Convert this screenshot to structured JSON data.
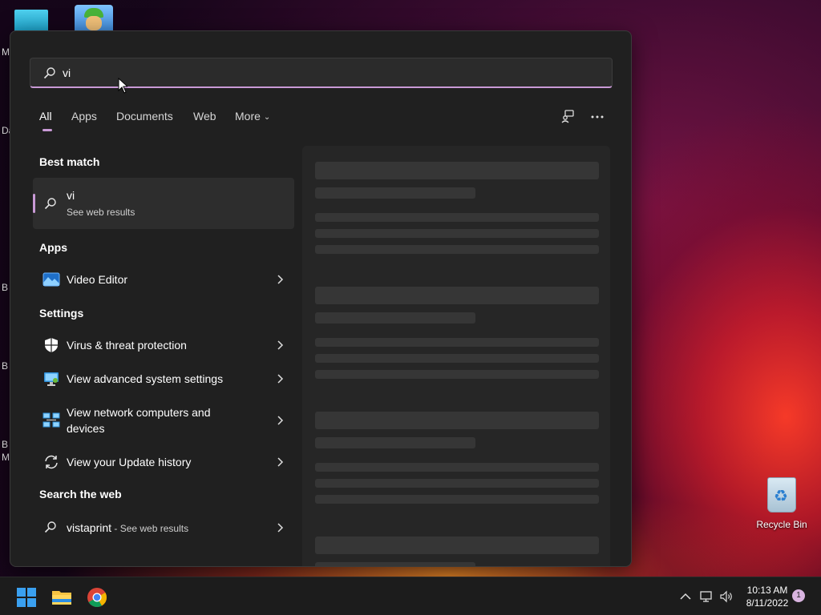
{
  "desktop": {
    "edge_letters": [
      "M",
      "Da",
      "B",
      "B",
      "B",
      "M"
    ],
    "recycle_bin_label": "Recycle Bin"
  },
  "search": {
    "query": "vi"
  },
  "tabs": [
    {
      "label": "All",
      "active": true
    },
    {
      "label": "Apps",
      "active": false
    },
    {
      "label": "Documents",
      "active": false
    },
    {
      "label": "Web",
      "active": false
    },
    {
      "label": "More",
      "active": false
    }
  ],
  "sections": {
    "best_match": "Best match",
    "apps": "Apps",
    "settings": "Settings",
    "search_web": "Search the web"
  },
  "best_match": {
    "title": "vi",
    "subtitle": "See web results"
  },
  "apps": [
    {
      "label": "Video Editor",
      "icon": "video-editor-icon"
    }
  ],
  "settings": [
    {
      "label": "Virus & threat protection",
      "icon": "shield-icon"
    },
    {
      "label": "View advanced system settings",
      "icon": "system-monitor-icon"
    },
    {
      "label": "View network computers and devices",
      "icon": "network-computers-icon"
    },
    {
      "label": "View your Update history",
      "icon": "update-refresh-icon"
    }
  ],
  "web_results": [
    {
      "label": "vistaprint",
      "suffix": " - See web results",
      "icon": "search-icon"
    }
  ],
  "taskbar": {
    "time": "10:13 AM",
    "date": "8/11/2022",
    "notification_count": "1"
  },
  "colors": {
    "accent": "#c99ad6",
    "panel_bg": "#202020",
    "taskbar_bg": "#1c1c1c"
  }
}
